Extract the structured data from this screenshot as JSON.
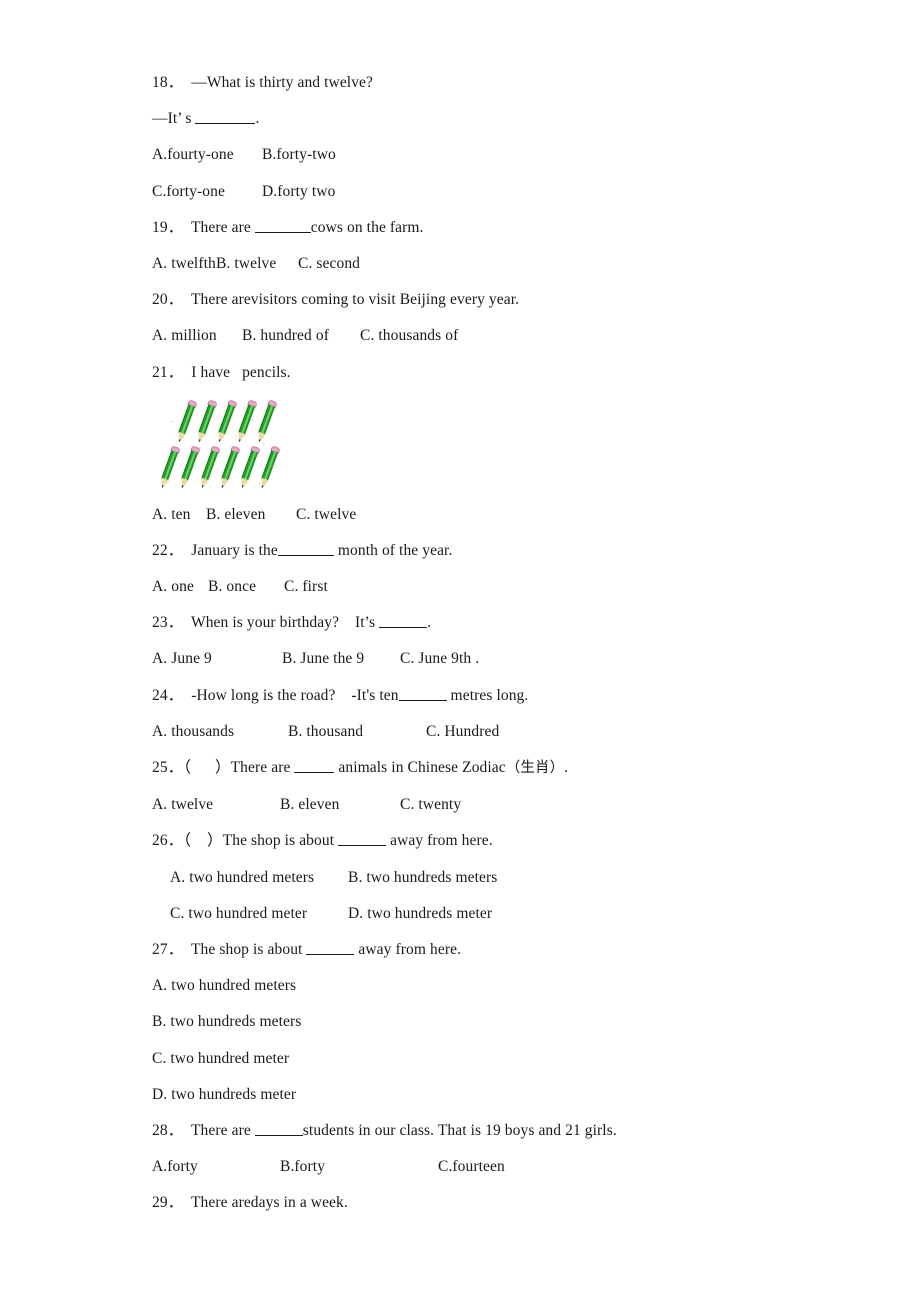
{
  "document": {
    "type": "worksheet",
    "language": "en-zh",
    "questions": [
      {
        "number": "18",
        "stem_lines": [
          "18．  —What is thirty and twelve?",
          "—It’ s ____________."
        ],
        "option_rows": [
          [
            "A.fourty-one",
            "B.forty-two"
          ],
          [
            "C.forty-one",
            "D.forty two"
          ]
        ]
      },
      {
        "number": "19",
        "stem_prefix": "19．  There are ",
        "stem_suffix": "cows on the farm.",
        "option_rows": [
          [
            "A. twelfth",
            "B. twelve",
            "C. second"
          ]
        ]
      },
      {
        "number": "20",
        "stem_lines": [
          "20．  There arevisitors coming to visit Beijing every year."
        ],
        "option_rows": [
          [
            "A. million",
            "B. hundred of",
            "C. thousands of"
          ]
        ]
      },
      {
        "number": "21",
        "stem_lines": [
          "21．  I have   pencils."
        ],
        "figure": {
          "name": "pencils-illustration",
          "description": "green pencils",
          "top_row_count": 5,
          "bottom_row_count": 6,
          "total_count": 11,
          "body_color": "#23a023",
          "eraser_color": "#e8a8c8",
          "tip_color": "#e8dba8"
        },
        "option_rows": [
          [
            "A. ten",
            "B. eleven",
            "C. twelve"
          ]
        ]
      },
      {
        "number": "22",
        "stem_prefix": "22．  January is the",
        "stem_suffix": " month of the year.",
        "option_rows": [
          [
            "A. one",
            "B. once",
            "C. first"
          ]
        ]
      },
      {
        "number": "23",
        "stem_prefix": "23．  When is your birthday?    It’s ",
        "stem_suffix": ".",
        "option_rows": [
          [
            "A. June 9",
            "B. June the 9",
            "C. June 9th ."
          ]
        ]
      },
      {
        "number": "24",
        "stem_prefix": "24．  -How long is the road?    -It's te",
        "stem_mid": "n",
        "stem_suffix": " metres long.",
        "option_rows": [
          [
            "A. thousands",
            "B. thousand",
            "C. Hundred"
          ]
        ]
      },
      {
        "number": "25",
        "stem_prefix": "25．（      ）There are ",
        "stem_suffix": " animals in Chinese Zodiac",
        "stem_cjk": "（生肖）",
        "stem_end": ".",
        "option_rows": [
          [
            "A. twelve",
            "B. eleven",
            "C. twenty"
          ]
        ]
      },
      {
        "number": "26",
        "stem_prefix": "26．（    ）The shop is about ",
        "stem_suffix": " away from here.",
        "option_rows": [
          [
            "A. two hundred meters",
            "B. two hundreds meters"
          ],
          [
            "C. two hundred meter",
            "D. two hundreds meter"
          ]
        ]
      },
      {
        "number": "27",
        "stem_prefix": "27．  The shop is about ",
        "stem_suffix": " away from here.",
        "option_rows": [
          [
            "A. two hundred meters"
          ],
          [
            "B. two hundreds meters"
          ],
          [
            "C. two hundred meter"
          ],
          [
            "D. two hundreds meter"
          ]
        ]
      },
      {
        "number": "28",
        "stem_prefix": "28．  There are ",
        "stem_suffix": "students in our class. That is 19 boys and 21 girls.",
        "option_rows": [
          [
            "A.forty",
            "B.forty",
            "C.fourteen"
          ]
        ]
      },
      {
        "number": "29",
        "stem_lines": [
          "29．  There aredays in a week."
        ],
        "option_rows": []
      }
    ]
  },
  "q18": {
    "stem1": "18．  —What is thirty and twelve?",
    "stem2_prefix": "—It’ s ",
    "stem2_suffix": ".",
    "optA": "A.fourty-one",
    "optB": "B.forty-two",
    "optC": "C.forty-one",
    "optD": "D.forty two"
  },
  "q19": {
    "stem_prefix": "19．  There are ",
    "stem_suffix": "cows on the farm.",
    "optA": "A. twelfth",
    "optB": "B. twelve",
    "optC": "C. second"
  },
  "q20": {
    "stem": "20．  There arevisitors coming to visit Beijing every year.",
    "optA": "A. million",
    "optB": "B. hundred of",
    "optC": "C. thousands of"
  },
  "q21": {
    "stem": "21．  I have   pencils.",
    "optA": "A. ten",
    "optB": "B. eleven",
    "optC": "C. twelve"
  },
  "q22": {
    "stem_prefix": "22．  January is the",
    "stem_suffix": " month of the year.",
    "optA": "A. one",
    "optB": "B. once",
    "optC": "C. first"
  },
  "q23": {
    "stem_prefix": "23．  When is your birthday?    It’s ",
    "stem_suffix": ".",
    "optA": "A. June 9",
    "optB": "B. June the 9",
    "optC": "C. June 9th ."
  },
  "q24": {
    "stem_prefix": "24．  -How long is the road?    -It's te",
    "stem_mid": "n",
    "stem_suffix": " metres long.",
    "optA": "A. thousands",
    "optB": "B. thousand",
    "optC": "C. Hundred"
  },
  "q25": {
    "stem_prefix": "25．（      ）There are ",
    "stem_mid": " animals in Chinese Zodiac",
    "stem_cjk": "（生肖）",
    "stem_end": ".",
    "optA": "A. twelve",
    "optB": "B. eleven",
    "optC": "C. twenty"
  },
  "q26": {
    "stem_prefix": "26．（    ）The shop is about ",
    "stem_suffix": " away from here.",
    "optA": "A. two hundred meters",
    "optB": "B. two hundreds meters",
    "optC": "C. two hundred meter",
    "optD": "D. two hundreds meter"
  },
  "q27": {
    "stem_prefix": "27．  The shop is about ",
    "stem_suffix": " away from here.",
    "optA": "A. two hundred meters",
    "optB": "B. two hundreds meters",
    "optC": "C. two hundred meter",
    "optD": "D. two hundreds meter"
  },
  "q28": {
    "stem_prefix": "28．  There are ",
    "stem_suffix": "students in our class. That is 19 boys and 21 girls.",
    "optA": "A.forty",
    "optB": "B.forty",
    "optC": "C.fourteen"
  },
  "q29": {
    "stem": "29．  There aredays in a week."
  }
}
